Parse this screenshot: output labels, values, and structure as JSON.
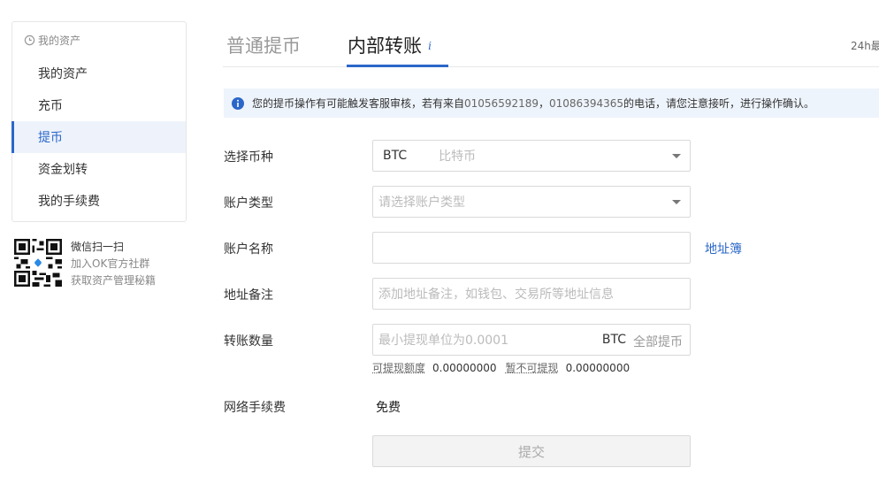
{
  "sidebar": {
    "header": "我的资产",
    "items": [
      {
        "label": "我的资产"
      },
      {
        "label": "充币"
      },
      {
        "label": "提币",
        "active": true
      },
      {
        "label": "资金划转"
      },
      {
        "label": "我的手续费"
      }
    ]
  },
  "qr": {
    "title": "微信扫一扫",
    "line1": "加入OK官方社群",
    "line2": "获取资产管理秘籍"
  },
  "tabs": {
    "normal": "普通提币",
    "internal": "内部转账",
    "active": "internal"
  },
  "top_right_text": "24h最",
  "notice": {
    "prefix": "您的提币操作有可能触发客服审核，若有来自",
    "phone1": "01056592189",
    "sep": "，",
    "phone2": "01086394365",
    "suffix": "的电话，请您注意接听，进行操作确认。"
  },
  "form": {
    "coin": {
      "label": "选择币种",
      "code": "BTC",
      "name": "比特币"
    },
    "account_type": {
      "label": "账户类型",
      "placeholder": "请选择账户类型"
    },
    "account_name": {
      "label": "账户名称",
      "value": "",
      "address_book": "地址簿"
    },
    "address_note": {
      "label": "地址备注",
      "placeholder": "添加地址备注，如钱包、交易所等地址信息"
    },
    "amount": {
      "label": "转账数量",
      "placeholder": "最小提现单位为0.0001",
      "unit": "BTC",
      "all": "全部提币",
      "available_label": "可提现额度",
      "available_value": "0.00000000",
      "unavailable_label": "暂不可提现",
      "unavailable_value": "0.00000000"
    },
    "network_fee": {
      "label": "网络手续费",
      "value": "免费"
    },
    "submit": "提交"
  },
  "colors": {
    "accent": "#2b67c9",
    "notice_bg": "#eef4fc",
    "active_bg": "#eef3fb"
  }
}
